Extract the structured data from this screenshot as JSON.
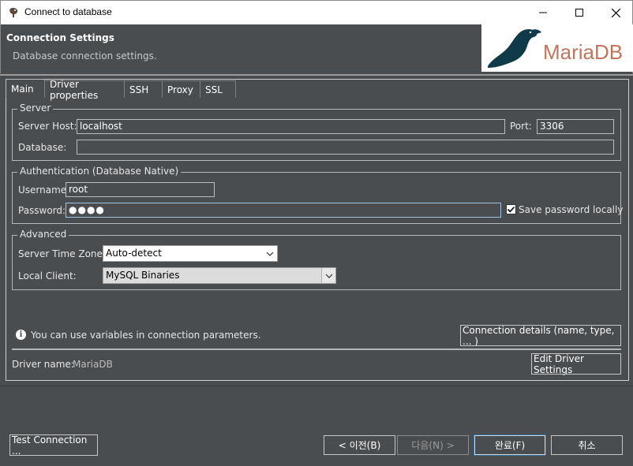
{
  "window": {
    "title": "Connect to database",
    "controls": {
      "minimize": "minimize-icon",
      "maximize": "maximize-icon",
      "close": "close-icon"
    }
  },
  "header": {
    "heading": "Connection Settings",
    "subheading": "Database connection settings.",
    "logo_text": "MariaDB"
  },
  "tabs": [
    {
      "label": "Main",
      "active": true
    },
    {
      "label": "Driver properties",
      "active": false
    },
    {
      "label": "SSH",
      "active": false
    },
    {
      "label": "Proxy",
      "active": false
    },
    {
      "label": "SSL",
      "active": false
    }
  ],
  "server": {
    "group_label": "Server",
    "host_label": "Server Host:",
    "host_value": "localhost",
    "port_label": "Port:",
    "port_value": "3306",
    "database_label": "Database:",
    "database_value": ""
  },
  "auth": {
    "group_label": "Authentication (Database Native)",
    "username_label": "Username:",
    "username_value": "root",
    "password_label": "Password:",
    "password_value": "●●●●",
    "save_password_label": "Save password locally",
    "save_password_checked": true
  },
  "advanced": {
    "group_label": "Advanced",
    "timezone_label": "Server Time Zone:",
    "timezone_value": "Auto-detect",
    "client_label": "Local Client:",
    "client_value": "MySQL Binaries"
  },
  "info": {
    "message": "You can use variables in connection parameters.",
    "details_button": "Connection details (name, type, ... )"
  },
  "driver": {
    "name_label": "Driver name:",
    "name_value": "MariaDB",
    "edit_button": "Edit Driver Settings"
  },
  "footer": {
    "test_button": "Test Connection ...",
    "back_button": "< 이전(B)",
    "next_button": "다음(N) >",
    "finish_button": "완료(F)",
    "cancel_button": "취소"
  }
}
